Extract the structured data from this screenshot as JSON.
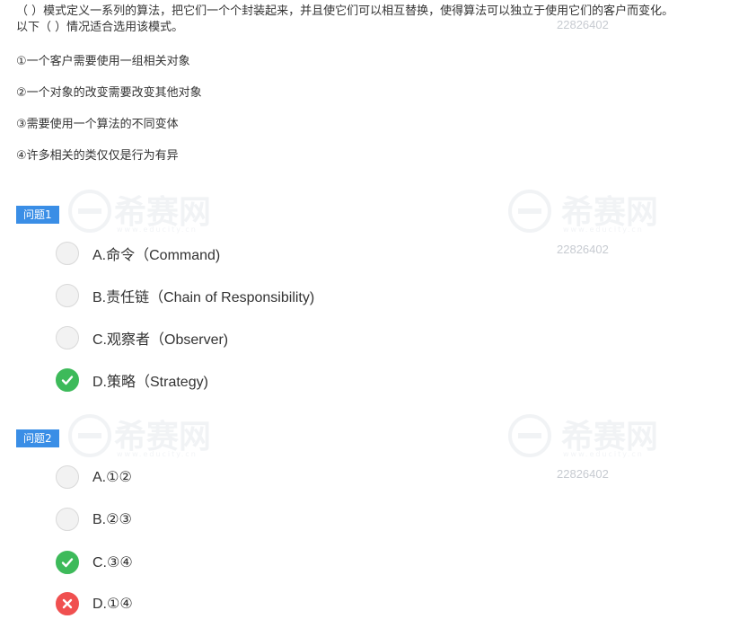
{
  "question": {
    "stem": [
      "（  ）模式定义一系列的算法，把它们一个个封装起来，并且使它们可以相互替换，使得算法可以独立于使用它们的客户而变化。",
      "以下（  ）情况适合选用该模式。"
    ],
    "options": [
      "①一个客户需要使用一组相关对象",
      "②一个对象的改变需要改变其他对象",
      "③需要使用一个算法的不同变体",
      "④许多相关的类仅仅是行为有异"
    ]
  },
  "sub_questions": [
    {
      "tag": "问题1",
      "choices": [
        {
          "label": "A.命令（Command)",
          "state": "unselected"
        },
        {
          "label": "B.责任链（Chain of Responsibility)",
          "state": "unselected"
        },
        {
          "label": "C.观察者（Observer)",
          "state": "unselected"
        },
        {
          "label": "D.策略（Strategy)",
          "state": "correct"
        }
      ]
    },
    {
      "tag": "问题2",
      "choices": [
        {
          "label": "A.①②",
          "state": "unselected"
        },
        {
          "label": "B.②③",
          "state": "unselected"
        },
        {
          "label": "C.③④",
          "state": "correct"
        },
        {
          "label": "D.①④",
          "state": "wrong"
        }
      ]
    }
  ],
  "watermark": {
    "brand": "希赛网",
    "domain": "www.educity.cn",
    "id": "22826402"
  },
  "colors": {
    "tag_bg": "#3a8ee6",
    "correct": "#3dba5a",
    "wrong": "#f05050",
    "radio_bg": "#f2f2f2"
  },
  "icons": {
    "correct": "check-icon",
    "wrong": "cross-icon"
  }
}
